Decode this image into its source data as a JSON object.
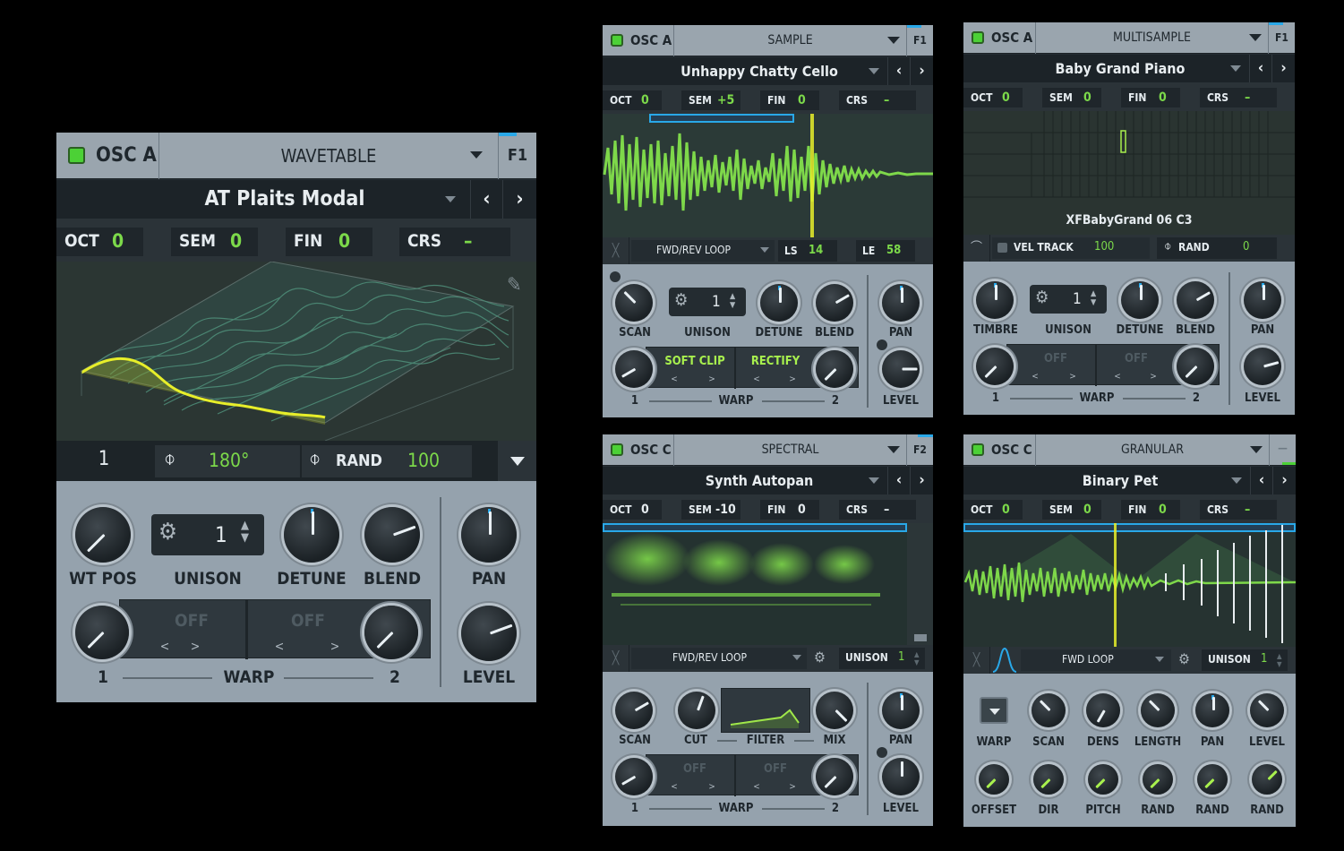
{
  "colors": {
    "accent_green": "#7cd94a",
    "led_green": "#4cd136",
    "accent_blue": "#29a8e8",
    "wave_yellow": "#e7ee2a"
  },
  "wavetable": {
    "osc_label": "OSC A",
    "type": "WAVETABLE",
    "fx_tab": "F1",
    "preset": "AT Plaits Modal",
    "params": [
      {
        "label": "OCT",
        "value": "0"
      },
      {
        "label": "SEM",
        "value": "0"
      },
      {
        "label": "FIN",
        "value": "0"
      },
      {
        "label": "CRS",
        "value": "–"
      }
    ],
    "frame": "1",
    "phase": "180°",
    "rand_label": "RAND",
    "rand_value": "100",
    "knobs": {
      "wt_pos": "WT POS",
      "unison": "UNISON",
      "unison_value": "1",
      "detune": "DETUNE",
      "blend": "BLEND",
      "pan": "PAN",
      "level": "LEVEL"
    },
    "warp": {
      "label": "WARP",
      "slot1": "OFF",
      "slot2": "OFF",
      "n1": "1",
      "n2": "2",
      "prev": "<",
      "next": ">"
    },
    "icons": [
      "pencil-icon",
      "phase-icon",
      "gear-icon",
      "chevron-down-icon"
    ]
  },
  "sample": {
    "osc_label": "OSC A",
    "type": "SAMPLE",
    "fx_tab": "F1",
    "preset": "Unhappy Chatty Cello",
    "params": [
      {
        "label": "OCT",
        "value": "0"
      },
      {
        "label": "SEM",
        "value": "+5"
      },
      {
        "label": "FIN",
        "value": "0"
      },
      {
        "label": "CRS",
        "value": "–"
      }
    ],
    "loop_mode": "FWD/REV LOOP",
    "ls_label": "LS",
    "ls_value": "14",
    "le_label": "LE",
    "le_value": "58",
    "knobs": {
      "scan": "SCAN",
      "unison": "UNISON",
      "unison_value": "1",
      "detune": "DETUNE",
      "blend": "BLEND",
      "pan": "PAN",
      "level": "LEVEL"
    },
    "warp": {
      "label": "WARP",
      "slot1": "SOFT CLIP",
      "slot2": "RECTIFY",
      "n1": "1",
      "n2": "2",
      "prev": "<",
      "next": ">"
    }
  },
  "multisample": {
    "osc_label": "OSC A",
    "type": "MULTISAMPLE",
    "fx_tab": "F1",
    "preset": "Baby Grand Piano",
    "params": [
      {
        "label": "OCT",
        "value": "0"
      },
      {
        "label": "SEM",
        "value": "0"
      },
      {
        "label": "FIN",
        "value": "0"
      },
      {
        "label": "CRS",
        "value": "–"
      }
    ],
    "sample_name": "XFBabyGrand 06 C3",
    "vel_track_label": "VEL TRACK",
    "vel_track_value": "100",
    "rand_label": "RAND",
    "rand_value": "0",
    "knobs": {
      "timbre": "TIMBRE",
      "unison": "UNISON",
      "unison_value": "1",
      "detune": "DETUNE",
      "blend": "BLEND",
      "pan": "PAN",
      "level": "LEVEL"
    },
    "warp": {
      "label": "WARP",
      "slot1": "OFF",
      "slot2": "OFF",
      "n1": "1",
      "n2": "2",
      "prev": "<",
      "next": ">"
    }
  },
  "spectral": {
    "osc_label": "OSC C",
    "type": "SPECTRAL",
    "fx_tab": "F2",
    "preset": "Synth Autopan",
    "params": [
      {
        "label": "OCT",
        "value": "0"
      },
      {
        "label": "SEM",
        "value": "-10"
      },
      {
        "label": "FIN",
        "value": "0"
      },
      {
        "label": "CRS",
        "value": "–"
      }
    ],
    "loop_mode": "FWD/REV LOOP",
    "unison_label": "UNISON",
    "unison_value": "1",
    "knobs": {
      "scan": "SCAN",
      "cut": "CUT",
      "filter": "FILTER",
      "mix": "MIX",
      "pan": "PAN",
      "level": "LEVEL"
    },
    "warp": {
      "label": "WARP",
      "slot1": "OFF",
      "slot2": "OFF",
      "n1": "1",
      "n2": "2",
      "prev": "<",
      "next": ">"
    }
  },
  "granular": {
    "osc_label": "OSC C",
    "type": "GRANULAR",
    "fx_tab": "—",
    "preset": "Binary Pet",
    "params": [
      {
        "label": "OCT",
        "value": "0"
      },
      {
        "label": "SEM",
        "value": "0"
      },
      {
        "label": "FIN",
        "value": "0"
      },
      {
        "label": "CRS",
        "value": "–"
      }
    ],
    "loop_mode": "FWD LOOP",
    "unison_label": "UNISON",
    "unison_value": "1",
    "knobs_row1": [
      "WARP",
      "SCAN",
      "DENS",
      "LENGTH",
      "PAN",
      "LEVEL"
    ],
    "knobs_row2": [
      "OFFSET",
      "DIR",
      "PITCH",
      "RAND",
      "RAND",
      "RAND"
    ]
  }
}
